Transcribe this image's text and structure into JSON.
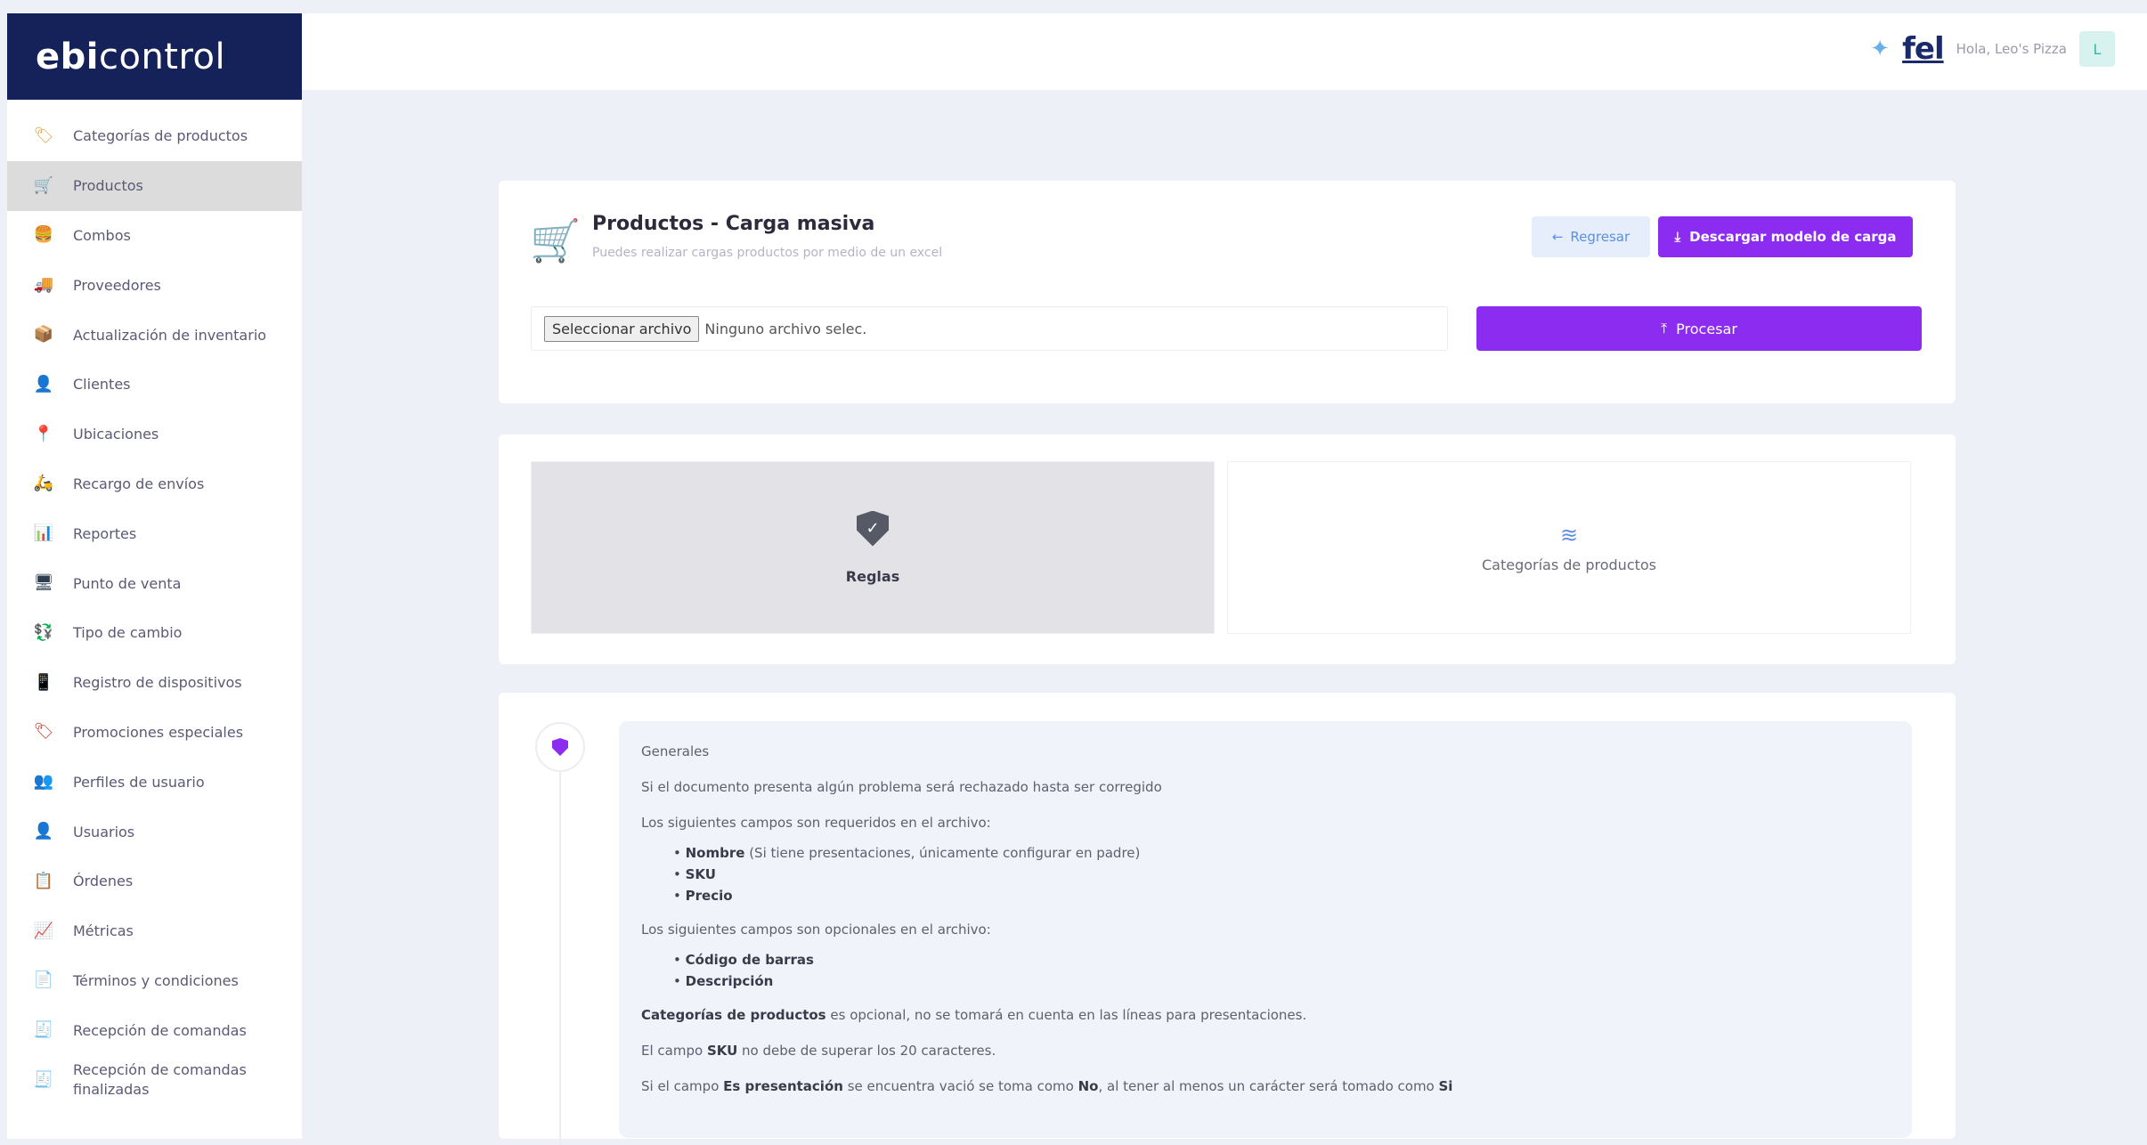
{
  "brand": {
    "part1": "ebi",
    "part2": "control"
  },
  "sidebar": {
    "items": [
      {
        "label": "Categorías de productos",
        "icon": "🏷",
        "color": "#e2a23a"
      },
      {
        "label": "Productos",
        "icon": "🛒",
        "color": "#c0392b",
        "active": true
      },
      {
        "label": "Combos",
        "icon": "🍔",
        "color": "#d4a017"
      },
      {
        "label": "Proveedores",
        "icon": "🚚",
        "color": "#2e6fb7"
      },
      {
        "label": "Actualización de inventario",
        "icon": "📦",
        "color": "#3d5a80"
      },
      {
        "label": "Clientes",
        "icon": "👤",
        "color": "#6b4f3a"
      },
      {
        "label": "Ubicaciones",
        "icon": "📍",
        "color": "#d35400"
      },
      {
        "label": "Recargo de envíos",
        "icon": "🛵",
        "color": "#8e2b2b"
      },
      {
        "label": "Reportes",
        "icon": "📊",
        "color": "#4a90d9"
      },
      {
        "label": "Punto de venta",
        "icon": "🖥",
        "color": "#2c3e50"
      },
      {
        "label": "Tipo de cambio",
        "icon": "💱",
        "color": "#16a085"
      },
      {
        "label": "Registro de dispositivos",
        "icon": "📱",
        "color": "#2980b9"
      },
      {
        "label": "Promociones especiales",
        "icon": "🏷",
        "color": "#c0392b"
      },
      {
        "label": "Perfiles de usuario",
        "icon": "👥",
        "color": "#6b4f3a"
      },
      {
        "label": "Usuarios",
        "icon": "👤",
        "color": "#5d4037"
      },
      {
        "label": "Órdenes",
        "icon": "📋",
        "color": "#1e6fb7"
      },
      {
        "label": "Métricas",
        "icon": "📈",
        "color": "#34495e"
      },
      {
        "label": "Términos y condiciones",
        "icon": "📄",
        "color": "#9b59b6"
      },
      {
        "label": "Recepción de comandas",
        "icon": "🧾",
        "color": "#555555"
      },
      {
        "label": "Recepción de comandas finalizadas",
        "icon": "🧾",
        "color": "#555555"
      }
    ]
  },
  "topbar": {
    "logo": "fel",
    "greeting": "Hola, Leo's Pizza",
    "avatar_letter": "L"
  },
  "header": {
    "title": "Productos - Carga masiva",
    "subtitle": "Puedes realizar cargas productos por medio de un excel",
    "back_label": "Regresar",
    "download_label": "Descargar modelo de carga"
  },
  "upload": {
    "file_button": "Seleccionar archivo",
    "file_status": "Ninguno archivo selec.",
    "process_label": "Procesar"
  },
  "tabs": [
    {
      "label": "Reglas",
      "active": true
    },
    {
      "label": "Categorías de productos",
      "active": false
    }
  ],
  "rules": {
    "heading": "Generales",
    "p1": "Si el documento presenta algún problema será rechazado hasta ser corregido",
    "required_intro": "Los siguientes campos son requeridos en el archivo:",
    "required": [
      {
        "name": "Nombre",
        "note": " (Si tiene presentaciones, únicamente configurar en padre)"
      },
      {
        "name": "SKU",
        "note": ""
      },
      {
        "name": "Precio",
        "note": ""
      }
    ],
    "optional_intro": "Los siguientes campos son opcionales en el archivo:",
    "optional": [
      {
        "name": "Código de barras"
      },
      {
        "name": "Descripción"
      }
    ],
    "cat_bold": "Categorías de productos",
    "cat_rest": " es opcional, no se tomará en cuenta en las líneas para presentaciones.",
    "sku_a": "El campo ",
    "sku_b": "SKU",
    "sku_c": " no debe de superar los 20 caracteres.",
    "pres_a": "Si el campo ",
    "pres_b": "Es presentación",
    "pres_c": " se encuentra vació se toma como ",
    "pres_d": "No",
    "pres_e": ", al tener al menos un carácter será tomado como ",
    "pres_f": "Si"
  },
  "colors": {
    "accent": "#8b2cf0",
    "brand": "#15225a",
    "back": "#5b8fe0"
  }
}
